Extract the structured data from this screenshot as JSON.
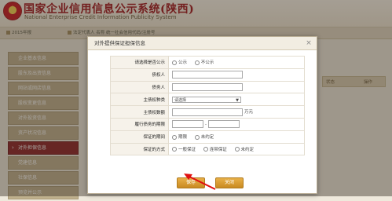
{
  "header": {
    "title": "国家企业信用信息公示系统(陕西)",
    "subtitle": "National Enterprise Credit Information Publicity System"
  },
  "strip": [
    "2015年报",
    "法定代表人 名称 统一社会信用代码/注册号"
  ],
  "sidebar": {
    "items": [
      {
        "label": "企业基本信息",
        "active": false
      },
      {
        "label": "股东及出资信息",
        "active": false
      },
      {
        "label": "网站或网店信息",
        "active": false
      },
      {
        "label": "股权变更信息",
        "active": false
      },
      {
        "label": "对外投资信息",
        "active": false
      },
      {
        "label": "资产状况信息",
        "active": false
      },
      {
        "label": "对外担保信息",
        "active": true
      },
      {
        "label": "党建信息",
        "active": false
      },
      {
        "label": "社保信息",
        "active": false
      },
      {
        "label": "预览并公示",
        "active": false
      }
    ]
  },
  "bg_table": {
    "status": "状态",
    "action": "操作"
  },
  "modal": {
    "title": "对外提供保证担保信息",
    "close": "×",
    "rows": {
      "publish": {
        "label": "请选择是否公示",
        "opt1": "公示",
        "opt2": "不公示"
      },
      "creditor": {
        "label": "债权人"
      },
      "debtor": {
        "label": "债务人"
      },
      "claim_type": {
        "label": "主债权种类",
        "value": "请选择"
      },
      "claim_amount": {
        "label": "主债权数额",
        "unit": "万元"
      },
      "period": {
        "label": "履行债务的期限",
        "sep": "-"
      },
      "guarantee_period": {
        "label": "保证的期间",
        "opt1": "期限",
        "opt2": "未约定"
      },
      "guarantee_method": {
        "label": "保证的方式",
        "opt1": "一般保证",
        "opt2": "连带保证",
        "opt3": "未约定"
      }
    },
    "save_label": "保存",
    "close_label": "关闭"
  }
}
